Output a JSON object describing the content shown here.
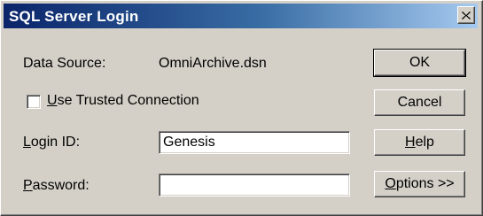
{
  "window": {
    "title": "SQL Server Login",
    "close_glyph": "×"
  },
  "fields": {
    "data_source_label": "Data Source:",
    "data_source_value": "OmniArchive.dsn",
    "trusted_connection_mnemonic": "U",
    "trusted_connection_rest": "se Trusted Connection",
    "trusted_connection_checked": false,
    "login_id_mnemonic": "L",
    "login_id_rest": "ogin ID:",
    "login_id_value": "Genesis",
    "password_mnemonic": "P",
    "password_rest": "assword:",
    "password_value": ""
  },
  "buttons": {
    "ok": "OK",
    "cancel": "Cancel",
    "help_mnemonic": "H",
    "help_rest": "elp",
    "options_mnemonic": "O",
    "options_rest": "ptions >>"
  },
  "icons": {
    "close": "close-icon"
  }
}
